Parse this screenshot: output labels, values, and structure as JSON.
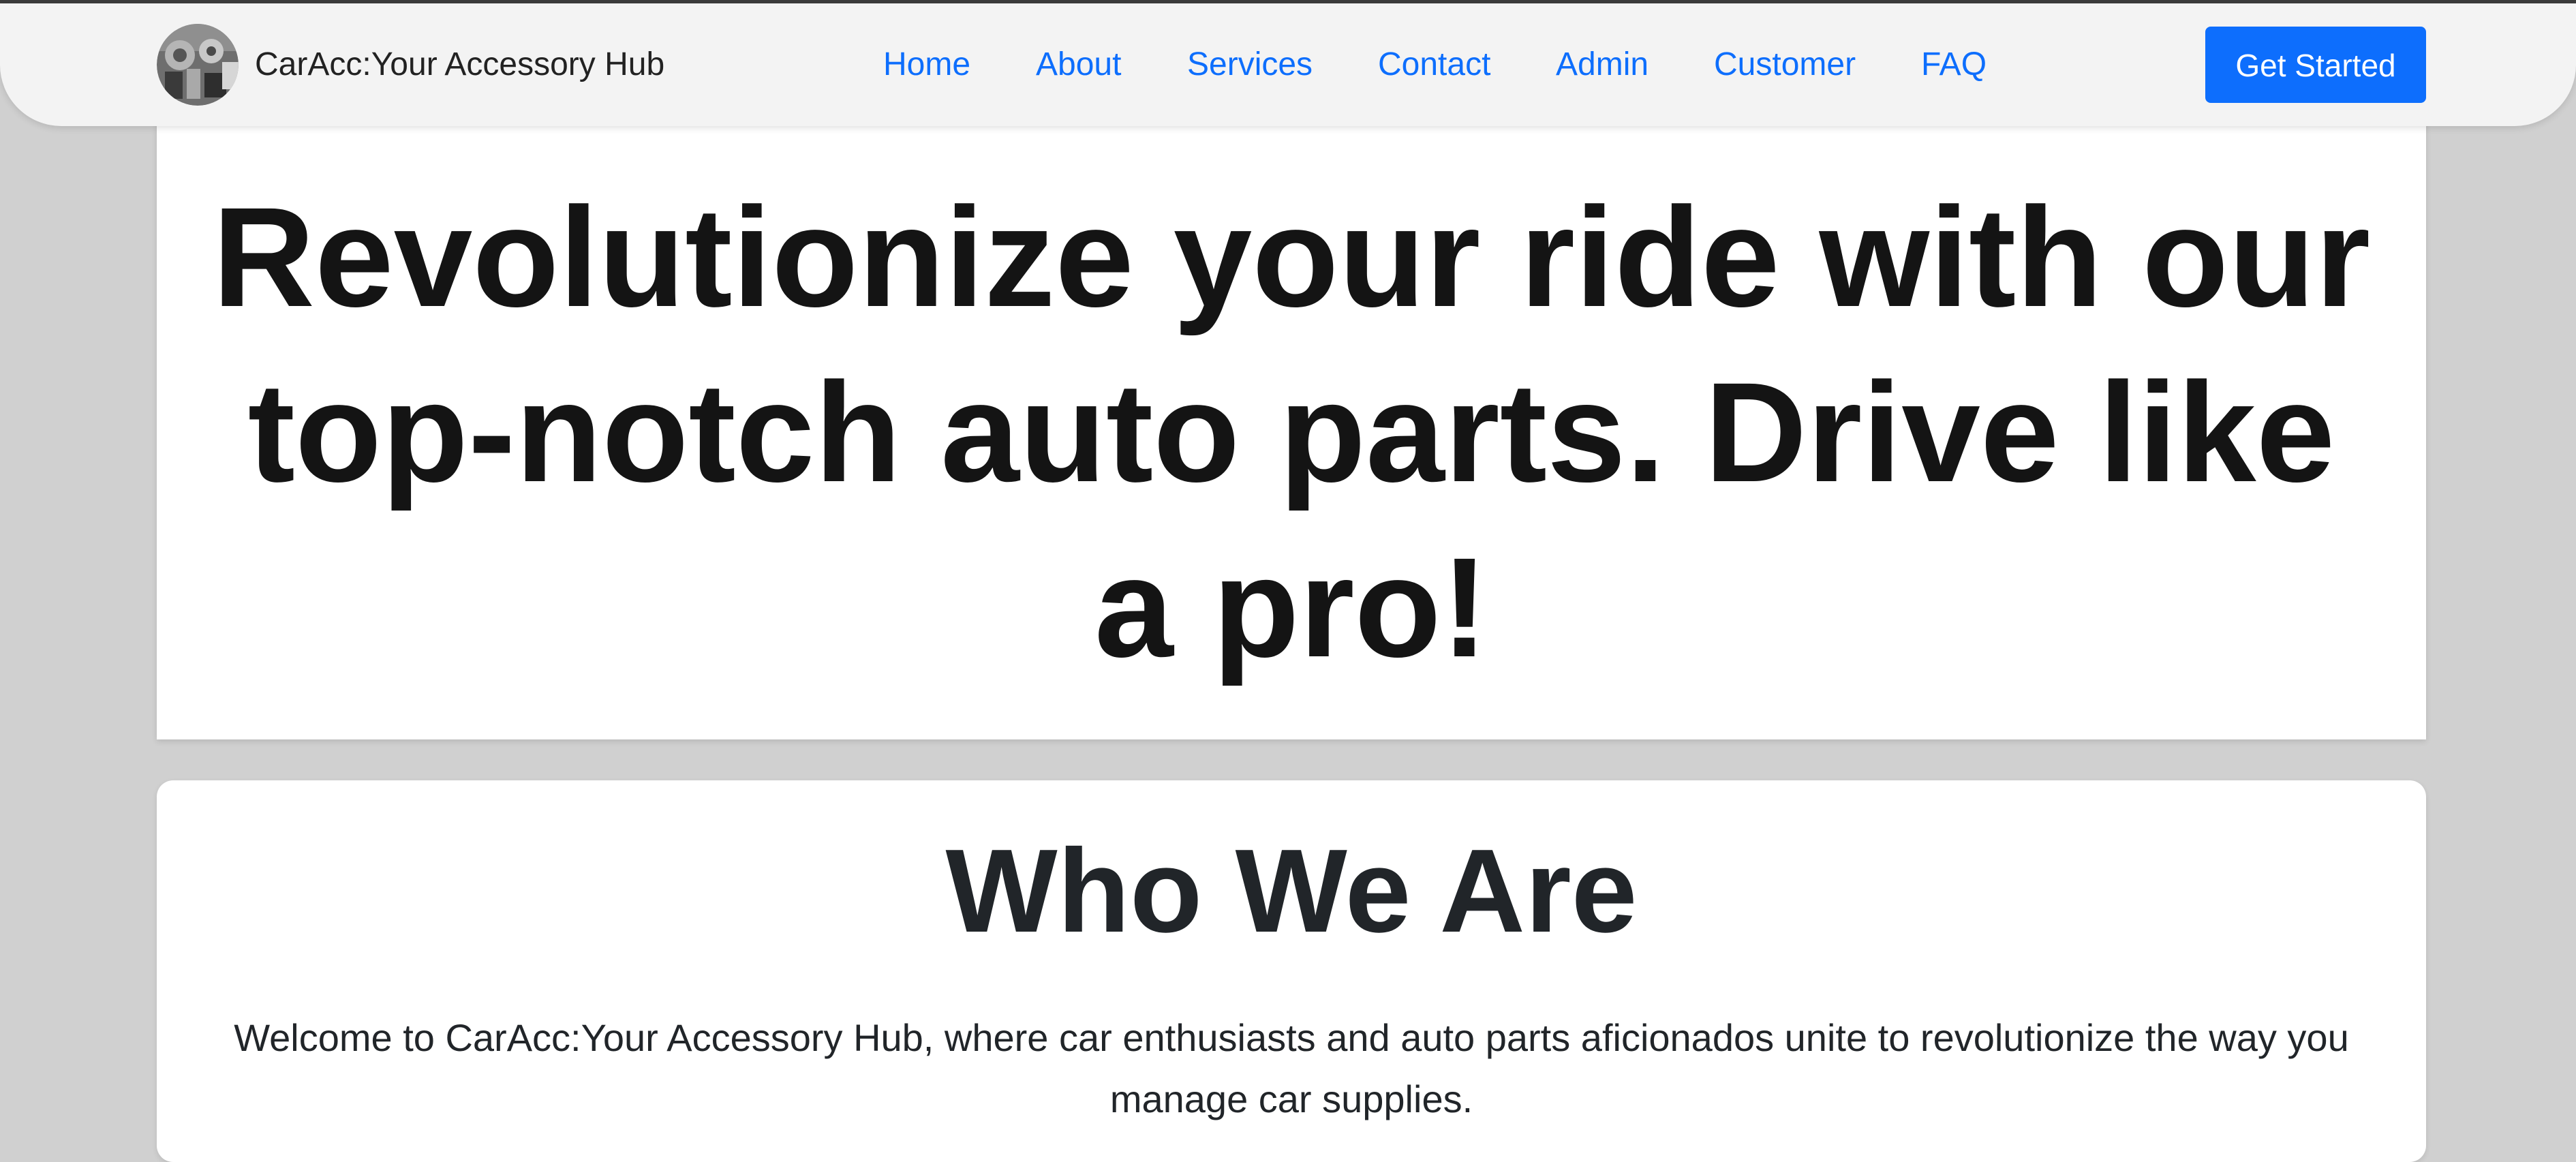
{
  "navbar": {
    "brand": "CarAcc:Your Accessory Hub",
    "links": [
      "Home",
      "About",
      "Services",
      "Contact",
      "Admin",
      "Customer",
      "FAQ"
    ],
    "cta_label": "Get Started",
    "accent_color": "#0d6efd",
    "logo_icon": "car-parts-logo-icon"
  },
  "hero": {
    "title": "Revolutionize your ride with our top-notch auto parts. Drive like a pro!"
  },
  "about": {
    "title": "Who We Are",
    "text": "Welcome to CarAcc:Your Accessory Hub, where car enthusiasts and auto parts aficionados unite to revolutionize the way you manage car supplies."
  }
}
